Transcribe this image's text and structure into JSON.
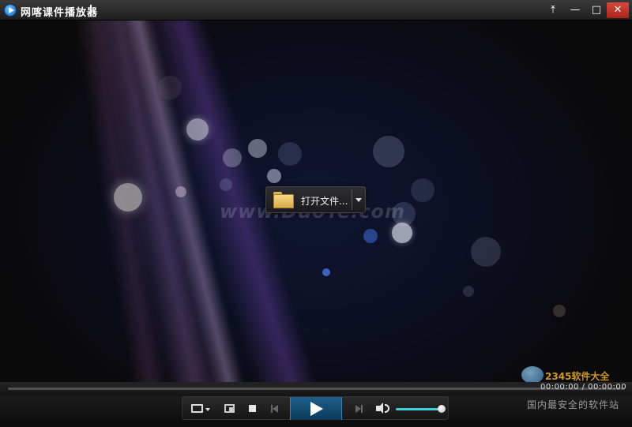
{
  "window": {
    "title": "网喀课件播放器",
    "buttons": {
      "pin": "⤒",
      "minimize": "—",
      "maximize": "□",
      "close": "✕"
    }
  },
  "stage": {
    "watermark": "www.DuoTe.com",
    "open_button": {
      "label": "打开文件..."
    }
  },
  "playback": {
    "elapsed": "00:00:00",
    "total": "00:00:00",
    "progress": 0,
    "volume": 1.0
  },
  "controls": {
    "icons": [
      "folder-open-icon",
      "picture-in-picture-icon",
      "stop-icon",
      "previous-icon",
      "play-icon",
      "next-icon",
      "volume-icon"
    ]
  },
  "overlay_logo": {
    "brand": "2345软件大全",
    "tagline": "国内最安全的软件站"
  },
  "colors": {
    "accent": "#3fd0d8",
    "play_button": "#1d5f8a",
    "close_button": "#c23a2c"
  }
}
